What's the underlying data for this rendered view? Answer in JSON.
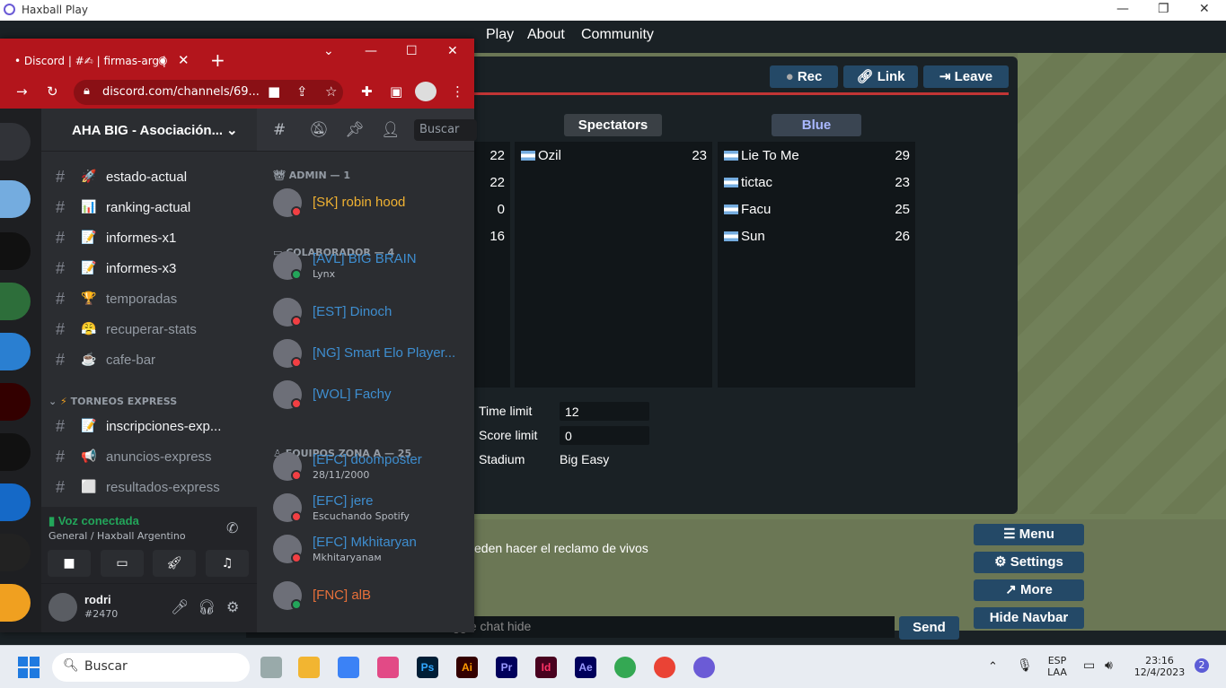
{
  "window": {
    "title": "Haxball Play"
  },
  "haxball": {
    "nav": [
      "Play",
      "About",
      "Community"
    ],
    "room_buttons": {
      "rec": "Rec",
      "link": "Link",
      "leave": "Leave"
    },
    "spectators_label": "Spectators",
    "blue_label": "Blue",
    "red_scores": [
      "22",
      "22",
      "0",
      "16"
    ],
    "spectators": [
      {
        "name": "Ozil",
        "score": "23"
      }
    ],
    "blue": [
      {
        "name": "Lie To Me",
        "score": "29"
      },
      {
        "name": "tictac",
        "score": "23"
      },
      {
        "name": "Facu",
        "score": "25"
      },
      {
        "name": "Sun",
        "score": "26"
      }
    ],
    "settings": {
      "time_limit_label": "Time limit",
      "time_limit": "12",
      "score_limit_label": "Score limit",
      "score_limit": "0",
      "stadium_label": "Stadium",
      "stadium": "Big Easy"
    },
    "chat_message": "eden hacer el reclamo de vivos",
    "chat_placeholder": "Press Tab or ESC to toggle chat hide",
    "send": "Send",
    "side_buttons": [
      "Menu",
      "Settings",
      "More",
      "Hide Navbar"
    ]
  },
  "chrome": {
    "tab_title": "• Discord | #✍ | firmas-arg |",
    "url": "discord.com/channels/69..."
  },
  "discord": {
    "guild_name": "AHA BIG - Asociación...",
    "search_placeholder": "Buscar",
    "channels": [
      {
        "emoji": "🚀",
        "name": "estado-actual",
        "unread": true
      },
      {
        "emoji": "📊",
        "name": "ranking-actual",
        "unread": true
      },
      {
        "emoji": "📝",
        "name": "informes-x1",
        "unread": true
      },
      {
        "emoji": "📝",
        "name": "informes-x3",
        "unread": true
      },
      {
        "emoji": "🏆",
        "name": "temporadas",
        "unread": false
      },
      {
        "emoji": "😤",
        "name": "recuperar-stats",
        "unread": false
      },
      {
        "emoji": "☕",
        "name": "cafe-bar",
        "unread": false
      }
    ],
    "category": "TORNEOS EXPRESS",
    "express_channels": [
      {
        "emoji": "📝",
        "name": "inscripciones-exp...",
        "unread": true
      },
      {
        "emoji": "📢",
        "name": "anuncios-express",
        "unread": false
      },
      {
        "emoji": "⬜",
        "name": "resultados-express",
        "unread": false
      }
    ],
    "voice": {
      "status": "Voz conectada",
      "channel": "General / Haxball Argentino"
    },
    "user": {
      "name": "rodri",
      "discriminator": "#2470"
    },
    "member_groups": [
      {
        "title": "ADMIN — 1",
        "members": [
          {
            "name": "[SK] robin hood",
            "sub": "",
            "color": "#f0b232",
            "status": "#f23f43"
          }
        ]
      },
      {
        "title": "COLABORADOR — 4",
        "members": [
          {
            "name": "[AVL] BIG BRAIN",
            "sub": "Lynx",
            "color": "#3e8ed0",
            "status": "#23a55a"
          },
          {
            "name": "[EST] Dinoch",
            "sub": "",
            "color": "#3e8ed0",
            "status": "#f23f43"
          },
          {
            "name": "[NG] Smart Elo Player...",
            "sub": "",
            "color": "#3e8ed0",
            "status": "#f23f43"
          },
          {
            "name": "[WOL] Fachy",
            "sub": "",
            "color": "#3e8ed0",
            "status": "#f23f43"
          }
        ]
      },
      {
        "title": "EQUIPOS ZONA A — 25",
        "members": [
          {
            "name": "[EFC] doomposter",
            "sub": "28/11/2000",
            "color": "#3e8ed0",
            "status": "#f23f43"
          },
          {
            "name": "[EFC] jere",
            "sub": "Escuchando Spotify",
            "color": "#3e8ed0",
            "status": "#f23f43"
          },
          {
            "name": "[EFC] Mkhitaryan",
            "sub": "Mkhitaryanам",
            "color": "#3e8ed0",
            "status": "#f23f43"
          },
          {
            "name": "[FNC] alB",
            "sub": "",
            "color": "#e8703a",
            "status": "#23a55a"
          }
        ]
      }
    ]
  },
  "taskbar": {
    "search": "Buscar",
    "lang": "ESP",
    "lang2": "LAA",
    "time": "23:16",
    "date": "12/4/2023",
    "badge": "2"
  }
}
